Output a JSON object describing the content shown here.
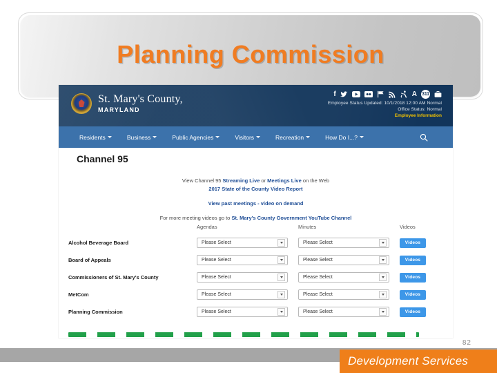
{
  "slide": {
    "title": "Planning Commission",
    "page_number": "82",
    "footer_label": "Development Services",
    "accent_orange": "#f07c22",
    "footer_orange": "#ef7f1a",
    "annotation_green": "#22a04a"
  },
  "site": {
    "brand_name": "St. Mary's County,",
    "brand_state": "MARYLAND",
    "social_icons": [
      "facebook-icon",
      "twitter-icon",
      "youtube-icon",
      "flickr-icon",
      "flag-icon",
      "rss-icon",
      "accessibility-icon",
      "text-size-icon",
      "311-badge-icon",
      "briefcase-icon"
    ],
    "badge_311": "311",
    "employee_status": "Employee Status Updated: 10/1/2018 12:00 AM Normal",
    "office_status": "Office Status: Normal",
    "employee_info_link": "Employee Information",
    "nav_items": [
      {
        "label": "Residents"
      },
      {
        "label": "Business"
      },
      {
        "label": "Public Agencies"
      },
      {
        "label": "Visitors"
      },
      {
        "label": "Recreation"
      },
      {
        "label": "How Do I...?"
      }
    ],
    "search_icon": "search-icon"
  },
  "page": {
    "heading": "Channel 95",
    "intro": {
      "line1_a": "View Channel 95 ",
      "line1_link1": "Streaming Live",
      "line1_b": " or ",
      "line1_link2": "Meetings Live",
      "line1_c": " on the Web",
      "line2_link": "2017 State of the County Video Report",
      "line3_link": "View past meetings - video on demand",
      "line4_a": "For more meeting videos go to ",
      "line4_link": "St. Mary's County Government YouTube Channel"
    },
    "table": {
      "columns": [
        "",
        "Agendas",
        "Minutes",
        "Videos"
      ],
      "select_placeholder": "Please Select",
      "videos_button_label": "Videos",
      "rows": [
        {
          "name": "Alcohol Beverage Board",
          "agendas": "Please Select",
          "minutes": "Please Select",
          "videos": "Videos"
        },
        {
          "name": "Board of Appeals",
          "agendas": "Please Select",
          "minutes": "Please Select",
          "videos": "Videos"
        },
        {
          "name": "Commissioners of St. Mary's County",
          "agendas": "Please Select",
          "minutes": "Please Select",
          "videos": "Videos"
        },
        {
          "name": "MetCom",
          "agendas": "Please Select",
          "minutes": "Please Select",
          "videos": "Videos"
        },
        {
          "name": "Planning Commission",
          "agendas": "Please Select",
          "minutes": "Please Select",
          "videos": "Videos"
        }
      ]
    }
  }
}
